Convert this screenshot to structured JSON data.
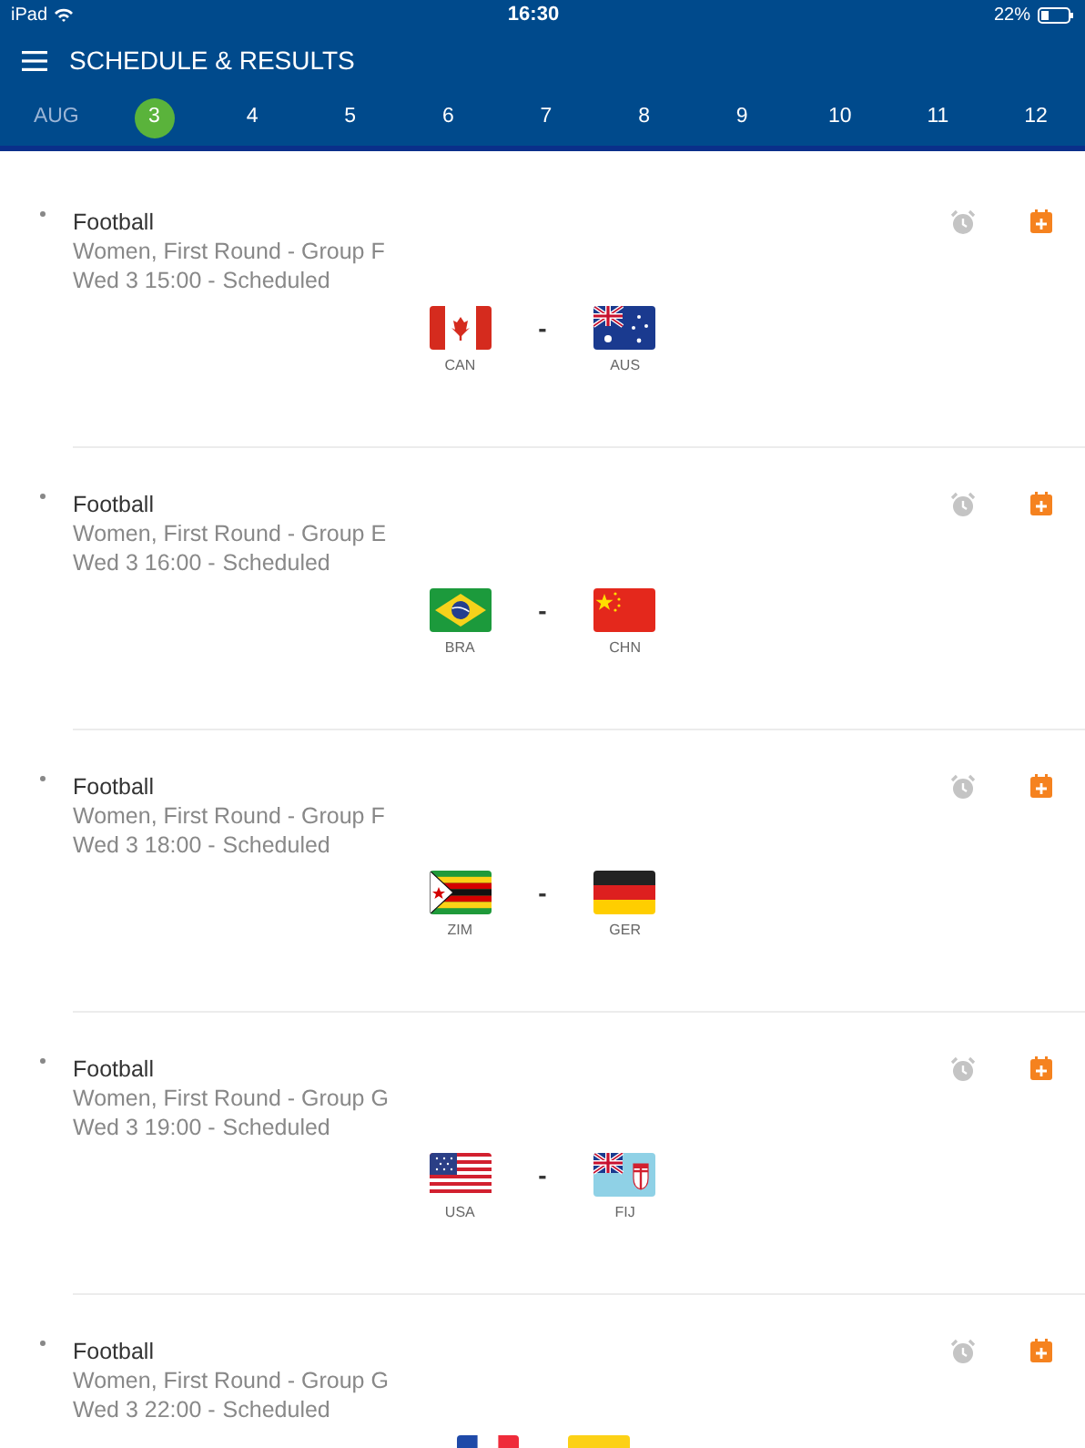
{
  "status_bar": {
    "device": "iPad",
    "time": "16:30",
    "battery": "22%"
  },
  "header": {
    "title": "SCHEDULE & RESULTS"
  },
  "dates": {
    "month": "AUG",
    "days": [
      {
        "label": "3",
        "selected": true
      },
      {
        "label": "4",
        "selected": false
      },
      {
        "label": "5",
        "selected": false
      },
      {
        "label": "6",
        "selected": false
      },
      {
        "label": "7",
        "selected": false
      },
      {
        "label": "8",
        "selected": false
      },
      {
        "label": "9",
        "selected": false
      },
      {
        "label": "10",
        "selected": false
      },
      {
        "label": "11",
        "selected": false
      },
      {
        "label": "12",
        "selected": false
      }
    ]
  },
  "matches": [
    {
      "sport": "Football",
      "event": "Women, First Round - Group F",
      "time": "Wed 3 15:00 -",
      "status": "Scheduled",
      "separator": "-",
      "teams": [
        {
          "code": "CAN"
        },
        {
          "code": "AUS"
        }
      ]
    },
    {
      "sport": "Football",
      "event": "Women, First Round - Group E",
      "time": "Wed 3 16:00 -",
      "status": "Scheduled",
      "separator": "-",
      "teams": [
        {
          "code": "BRA"
        },
        {
          "code": "CHN"
        }
      ]
    },
    {
      "sport": "Football",
      "event": "Women, First Round - Group F",
      "time": "Wed 3 18:00 -",
      "status": "Scheduled",
      "separator": "-",
      "teams": [
        {
          "code": "ZIM"
        },
        {
          "code": "GER"
        }
      ]
    },
    {
      "sport": "Football",
      "event": "Women, First Round - Group G",
      "time": "Wed 3 19:00 -",
      "status": "Scheduled",
      "separator": "-",
      "teams": [
        {
          "code": "USA"
        },
        {
          "code": "FIJ"
        }
      ]
    },
    {
      "sport": "Football",
      "event": "Women, First Round - Group G",
      "time": "Wed 3 22:00 -",
      "status": "Scheduled"
    }
  ]
}
